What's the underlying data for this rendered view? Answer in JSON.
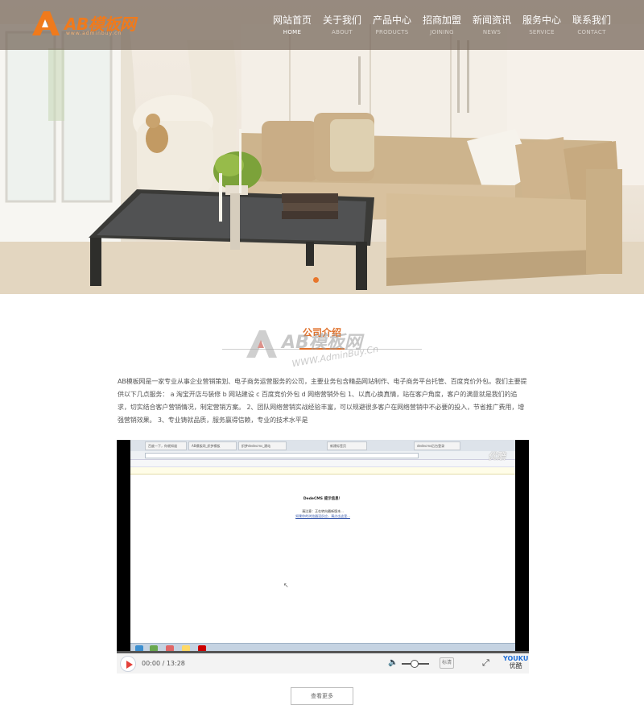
{
  "header": {
    "logo_text": "AB模板网",
    "logo_sub": "www.adminbuy.cn",
    "nav": [
      {
        "cn": "网站首页",
        "en": "HOME",
        "active": true
      },
      {
        "cn": "关于我们",
        "en": "ABOUT",
        "active": false
      },
      {
        "cn": "产品中心",
        "en": "PRODUCTS",
        "active": false
      },
      {
        "cn": "招商加盟",
        "en": "JOINING",
        "active": false
      },
      {
        "cn": "新闻资讯",
        "en": "NEWS",
        "active": false
      },
      {
        "cn": "服务中心",
        "en": "SERVICE",
        "active": false
      },
      {
        "cn": "联系我们",
        "en": "CONTACT",
        "active": false
      }
    ]
  },
  "colors": {
    "accent": "#e0702a",
    "logo_orange": "#f07a1c"
  },
  "intro": {
    "title": "公司介绍",
    "watermark_text": "AB模板网",
    "watermark_url": "WWW.AdminBuy.Cn",
    "paragraph": "AB模板网是一家专业从事企业营销策划、电子商务运营服务的公司，主要业务包含精品网站制作、电子商务平台托管、百度竞价外包。我们主要提供以下几点服务： a 淘宝开店与装修 b 网站建设 c 百度竞价外包 d 网络营销外包 1、以真心换真情，站在客户角度，客户的满意就是我们的追求，切实结合客户营销情况，制定营销方案。 2、团队网络营销实战经验丰富，可以规避很多客户在网络营销中不必要的投入，节省推广费用，增强营销效果。 3、专业铸就品质，服务赢得信赖，专业的技术水平是"
  },
  "video": {
    "time": "00:00 / 13:28",
    "quality": "标清",
    "brand_en": "YOUKU",
    "brand_cn": "优酷",
    "overlay_watermark": "优酷",
    "screen": {
      "tabs": [
        "百度一下，你就知道",
        "AB模板网_织梦模板",
        "织梦dedecms_建站",
        "新建标签页",
        "dedecms后台登录"
      ],
      "heading": "DedeCMS 提示信息！",
      "line": "请注意：正在转向最新版本...",
      "link": "如果你的浏览器没反应，请点击这里..."
    }
  },
  "more_button": "查看更多"
}
